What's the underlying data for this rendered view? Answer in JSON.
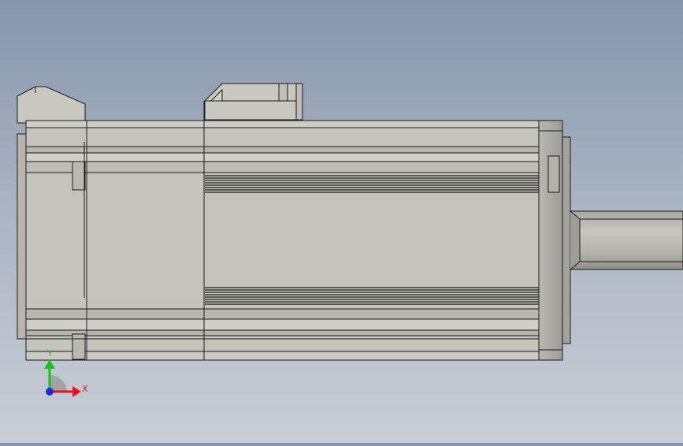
{
  "viewport": {
    "view": "cad-model-side-view",
    "model": "servo-motor"
  },
  "triad": {
    "x_label": "X",
    "y_label": "Y",
    "x_color": "#e0161b",
    "y_color": "#17c21d",
    "z_color": "#1b2bd8"
  },
  "colors": {
    "body": "#c4c4bd",
    "body_light": "#d4d4cd",
    "body_dark": "#9a9a93",
    "edge": "#1a1a1a",
    "shaft": "#b4b4ad"
  }
}
